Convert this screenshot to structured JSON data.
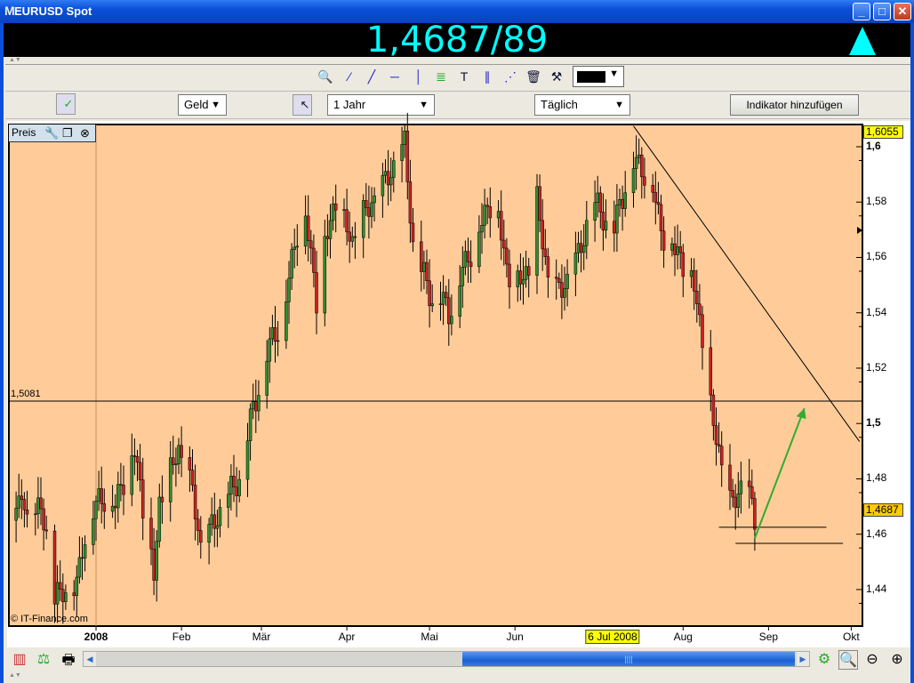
{
  "window": {
    "title": "EURUSD Spot",
    "logo": "M"
  },
  "quote": {
    "price": "1,4687/89",
    "direction": "up",
    "color": "#00ffff"
  },
  "toolbar": {
    "tools": [
      "pointer-icon",
      "zoom-in-icon",
      "line-icon",
      "trendline-icon",
      "horizontal-line-icon",
      "vertical-line-icon",
      "fibonacci-icon",
      "text-icon",
      "channel-icon",
      "segment-icon",
      "trash-icon",
      "tools-icon"
    ],
    "line_color": "#000000"
  },
  "controls": {
    "price_type": "Geld",
    "period": "1 Jahr",
    "interval": "Täglich",
    "add_indicator": "Indikator hinzufügen"
  },
  "panel": {
    "label": "Preis"
  },
  "chart_data": {
    "type": "candlestick",
    "title": "EURUSD Spot",
    "x_unit": "days since 2008-01-01",
    "xticks": [
      {
        "label": "2008",
        "day": 0
      },
      {
        "label": "Feb",
        "day": 31
      },
      {
        "label": "Mär",
        "day": 60
      },
      {
        "label": "Apr",
        "day": 91
      },
      {
        "label": "Mai",
        "day": 121
      },
      {
        "label": "Jun",
        "day": 152
      },
      {
        "label": "Aug",
        "day": 213
      },
      {
        "label": "Sep",
        "day": 244
      },
      {
        "label": "Okt",
        "day": 274
      }
    ],
    "highlight_xlabel": {
      "label": "6 Jul 2008",
      "day": 187
    },
    "yticks": [
      "1,44",
      "1,46",
      "1,48",
      "1,5",
      "1,52",
      "1,54",
      "1,56",
      "1,58",
      "1,6"
    ],
    "ytick_values": [
      1.44,
      1.46,
      1.48,
      1.5,
      1.52,
      1.54,
      1.56,
      1.58,
      1.6
    ],
    "ylim": [
      1.427,
      1.608
    ],
    "close_anchors": [
      [
        -29,
        1.465
      ],
      [
        -27,
        1.475
      ],
      [
        -24,
        1.46
      ],
      [
        -20,
        1.47
      ],
      [
        -17,
        1.455
      ],
      [
        -15,
        1.435
      ],
      [
        -12,
        1.44
      ],
      [
        -7,
        1.44
      ],
      [
        -5,
        1.455
      ],
      [
        -3,
        1.465
      ],
      [
        0,
        1.47
      ],
      [
        4,
        1.475
      ],
      [
        7,
        1.47
      ],
      [
        10,
        1.48
      ],
      [
        14,
        1.49
      ],
      [
        17,
        1.47
      ],
      [
        21,
        1.445
      ],
      [
        23,
        1.47
      ],
      [
        26,
        1.48
      ],
      [
        30,
        1.49
      ],
      [
        35,
        1.475
      ],
      [
        38,
        1.455
      ],
      [
        41,
        1.46
      ],
      [
        46,
        1.47
      ],
      [
        52,
        1.48
      ],
      [
        57,
        1.505
      ],
      [
        62,
        1.525
      ],
      [
        68,
        1.54
      ],
      [
        73,
        1.57
      ],
      [
        76,
        1.575
      ],
      [
        80,
        1.545
      ],
      [
        83,
        1.565
      ],
      [
        87,
        1.58
      ],
      [
        93,
        1.565
      ],
      [
        97,
        1.575
      ],
      [
        104,
        1.585
      ],
      [
        109,
        1.595
      ],
      [
        112,
        1.6
      ],
      [
        115,
        1.565
      ],
      [
        118,
        1.555
      ],
      [
        122,
        1.545
      ],
      [
        125,
        1.545
      ],
      [
        128,
        1.54
      ],
      [
        133,
        1.555
      ],
      [
        143,
        1.58
      ],
      [
        146,
        1.575
      ],
      [
        149,
        1.555
      ],
      [
        152,
        1.55
      ],
      [
        157,
        1.555
      ],
      [
        160,
        1.58
      ],
      [
        165,
        1.545
      ],
      [
        170,
        1.55
      ],
      [
        175,
        1.56
      ],
      [
        180,
        1.58
      ],
      [
        188,
        1.57
      ],
      [
        194,
        1.595
      ],
      [
        201,
        1.59
      ],
      [
        205,
        1.57
      ],
      [
        212,
        1.56
      ],
      [
        217,
        1.55
      ],
      [
        220,
        1.53
      ],
      [
        223,
        1.505
      ],
      [
        226,
        1.49
      ],
      [
        230,
        1.47
      ],
      [
        233,
        1.475
      ],
      [
        235,
        1.48
      ],
      [
        239,
        1.465
      ]
    ],
    "hline": {
      "value": 1.5081,
      "label": "1,5081"
    },
    "max_label": "1,6055",
    "last_label": "1,4687",
    "trendline": [
      [
        195,
        1.6075
      ],
      [
        277,
        1.4935
      ]
    ],
    "support_lines": [
      {
        "from": 226,
        "to": 265,
        "value": 1.4625
      },
      {
        "from": 232,
        "to": 271,
        "value": 1.4567
      }
    ],
    "arrow": {
      "from": [
        239,
        1.4585
      ],
      "to": [
        257,
        1.5055
      ],
      "color": "#33aa33"
    },
    "up_color": "#2f8f2f",
    "down_color": "#cc2222"
  },
  "copyright": "© IT-Finance.com",
  "bottom": {
    "tools": [
      "chart-type-icon",
      "indicators-icon",
      "print-icon"
    ],
    "right_tools": [
      "settings-icon",
      "autoscale-icon",
      "zoom-out-icon",
      "zoom-in-icon"
    ]
  }
}
